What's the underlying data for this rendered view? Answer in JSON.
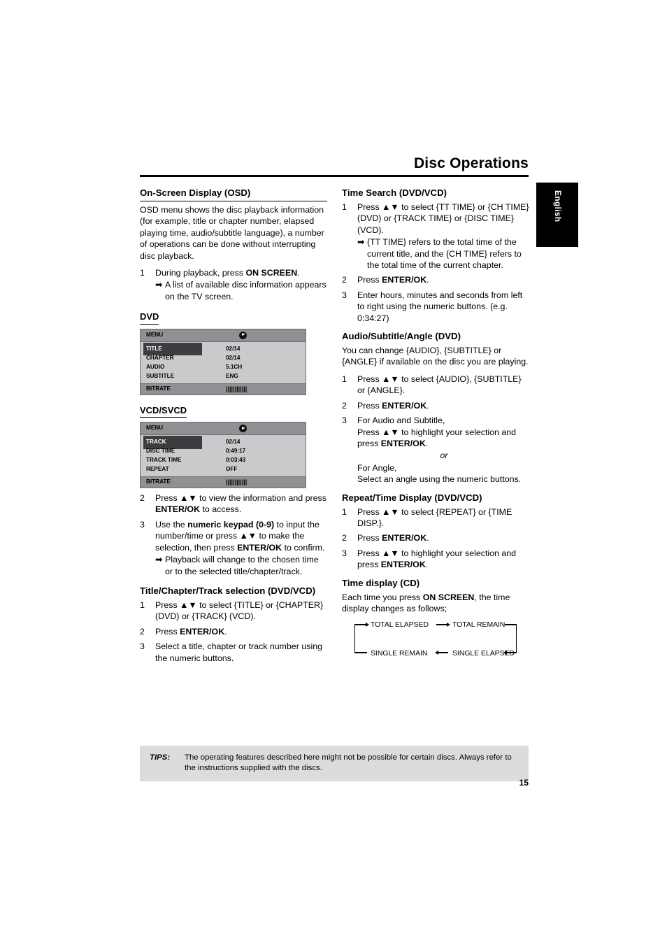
{
  "header": {
    "title": "Disc Operations",
    "side_tab": "English"
  },
  "left": {
    "osd_heading": "On-Screen Display (OSD)",
    "osd_intro": "OSD menu shows the disc playback information (for example, title or chapter number, elapsed playing time, audio/subtitle language), a number of operations can be done without interrupting disc playback.",
    "step1_num": "1",
    "step1_text_a": "During playback, press ",
    "step1_text_b": "ON SCREEN",
    "step1_text_c": ".",
    "step1_sub": "A list of available disc information appears on the TV screen.",
    "dvd_label": "DVD",
    "dvd_osd": {
      "menu_label": "MENU",
      "rows": [
        {
          "key": "TITLE",
          "value": "02/14",
          "highlight": true
        },
        {
          "key": "CHAPTER",
          "value": "02/14",
          "highlight": false
        },
        {
          "key": "AUDIO",
          "value": "5.1CH",
          "highlight": false
        },
        {
          "key": "SUBTITLE",
          "value": "ENG",
          "highlight": false
        }
      ],
      "bitrate_label": "BITRATE",
      "bitrate_bars": "||||||||||||"
    },
    "vcd_label": "VCD/SVCD",
    "vcd_osd": {
      "menu_label": "MENU",
      "rows": [
        {
          "key": "TRACK",
          "value": "02/14",
          "highlight": true
        },
        {
          "key": "DISC TIME",
          "value": "0:49:17",
          "highlight": false
        },
        {
          "key": "TRACK TIME",
          "value": "0:03:43",
          "highlight": false
        },
        {
          "key": "REPEAT",
          "value": "OFF",
          "highlight": false
        }
      ],
      "bitrate_label": "BITRATE",
      "bitrate_bars": "||||||||||||"
    },
    "step2_num": "2",
    "step2_a": "Press ",
    "step2_nav": "▲▼",
    "step2_b": " to view the information and press ",
    "step2_bold": "ENTER/OK",
    "step2_c": " to access.",
    "step3_num": "3",
    "step3_a": "Use the ",
    "step3_bold1": "numeric keypad (0-9)",
    "step3_b": " to input the number/time or press ",
    "step3_nav": "▲▼",
    "step3_c": " to make the selection, then press ",
    "step3_bold2": "ENTER/OK",
    "step3_d": " to confirm.",
    "step3_sub": "Playback will change to the chosen time or to the selected title/chapter/track.",
    "tcs_heading": "Title/Chapter/Track selection (DVD/VCD)",
    "tcs_1_num": "1",
    "tcs_1_a": "Press ",
    "tcs_1_nav": "▲▼",
    "tcs_1_b": " to select {TITLE} or {CHAPTER} (DVD) or {TRACK} (VCD).",
    "tcs_2_num": "2",
    "tcs_2_a": "Press ",
    "tcs_2_bold": "ENTER/OK",
    "tcs_2_b": ".",
    "tcs_3_num": "3",
    "tcs_3_text": "Select a title, chapter or track number using the numeric buttons."
  },
  "right": {
    "time_search_heading": "Time Search (DVD/VCD)",
    "ts_1_num": "1",
    "ts_1_a": "Press ",
    "ts_1_nav": "▲▼",
    "ts_1_b": " to select {TT TIME} or {CH TIME} (DVD) or {TRACK TIME} or {DISC TIME} (VCD).",
    "ts_1_sub": "{TT TIME} refers to the total time of the current title, and the {CH TIME} refers to the total time of the current chapter.",
    "ts_2_num": "2",
    "ts_2_a": "Press ",
    "ts_2_bold": "ENTER/OK",
    "ts_2_b": ".",
    "ts_3_num": "3",
    "ts_3_text": "Enter hours, minutes and seconds from left to right using the numeric buttons. (e.g. 0:34:27)",
    "asa_heading": "Audio/Subtitle/Angle (DVD)",
    "asa_intro": "You can change {AUDIO}, {SUBTITLE} or {ANGLE} if available on the disc you are playing.",
    "asa_1_num": "1",
    "asa_1_a": "Press ",
    "asa_1_nav": "▲▼",
    "asa_1_b": " to select {AUDIO}, {SUBTITLE} or {ANGLE}.",
    "asa_2_num": "2",
    "asa_2_a": "Press ",
    "asa_2_bold": "ENTER/OK",
    "asa_2_b": ".",
    "asa_3_num": "3",
    "asa_3_line1": "For Audio and Subtitle,",
    "asa_3_line2a": "Press ",
    "asa_3_nav": "▲▼",
    "asa_3_line2b": " to highlight your selection and press ",
    "asa_3_bold": "ENTER/OK",
    "asa_3_line2c": ".",
    "asa_3_or": "or",
    "asa_3_line3": "For Angle,",
    "asa_3_line4": "Select an angle using the numeric buttons.",
    "repeat_heading": "Repeat/Time Display (DVD/VCD)",
    "rp_1_num": "1",
    "rp_1_a": "Press ",
    "rp_1_nav": "▲▼",
    "rp_1_b": " to select {REPEAT} or {TIME DISP.}.",
    "rp_2_num": "2",
    "rp_2_a": "Press ",
    "rp_2_bold": "ENTER/OK",
    "rp_2_b": ".",
    "rp_3_num": "3",
    "rp_3_a": "Press ",
    "rp_3_nav": "▲▼",
    "rp_3_b": " to highlight your selection and press ",
    "rp_3_bold": "ENTER/OK",
    "rp_3_c": ".",
    "cd_heading": "Time display (CD)",
    "cd_intro_a": "Each time you press ",
    "cd_intro_bold": "ON SCREEN",
    "cd_intro_b": ", the time display changes as follows;",
    "cd_diagram": {
      "total_elapsed": "TOTAL ELAPSED",
      "total_remain": "TOTAL REMAIN",
      "single_remain": "SINGLE REMAIN",
      "single_elapsed": "SINGLE ELAPSED"
    }
  },
  "tips": {
    "label": "TIPS:",
    "text": "The operating features described here might not be possible for certain discs. Always refer to the instructions supplied with the discs."
  },
  "page_number": "15"
}
